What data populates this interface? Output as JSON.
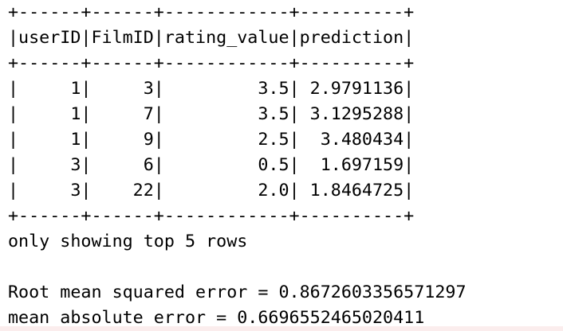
{
  "table": {
    "border_top": "+------+------+------------+----------+",
    "header_row": "|userID|FilmID|rating_value|prediction|",
    "border_mid": "+------+------+------------+----------+",
    "rows": [
      "|     1|     3|         3.5| 2.9791136|",
      "|     1|     7|         3.5| 3.1295288|",
      "|     1|     9|         2.5|  3.480434|",
      "|     3|     6|         0.5|  1.697159|",
      "|     3|    22|         2.0| 1.8464725|"
    ],
    "border_bottom": "+------+------+------------+----------+"
  },
  "notice": "only showing top 5 rows",
  "metrics": {
    "rmse": "Root mean squared error = 0.8672603356571297",
    "mae": "mean absolute error = 0.6696552465020411"
  },
  "colors": {
    "bottom_strip": "#fbeded"
  }
}
